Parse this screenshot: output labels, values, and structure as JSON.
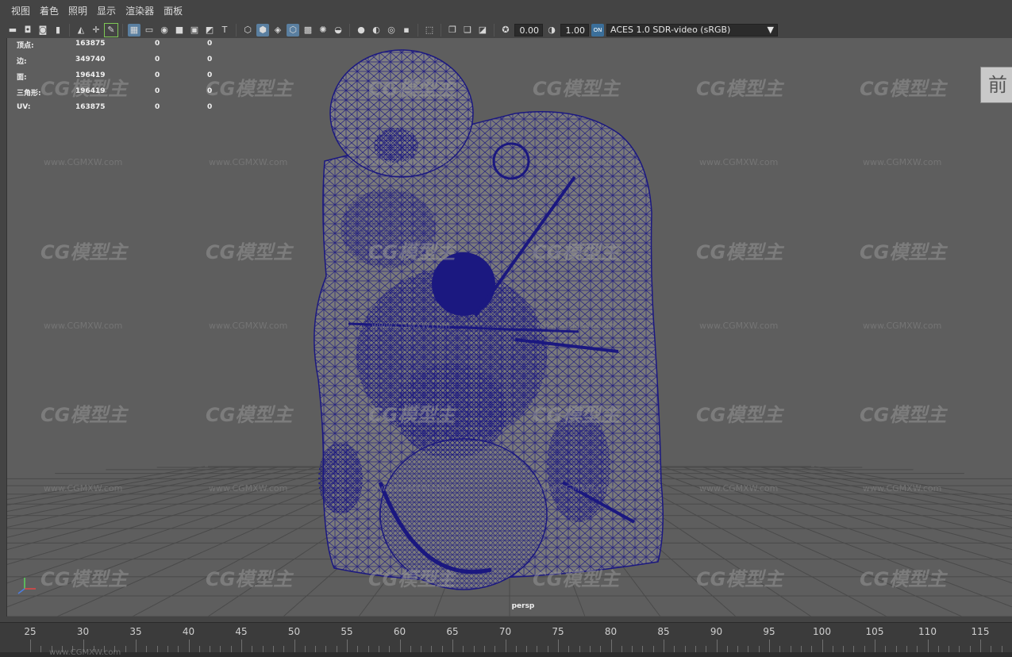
{
  "menu": {
    "items": [
      "视图",
      "着色",
      "照明",
      "显示",
      "渲染器",
      "面板"
    ]
  },
  "toolbar": {
    "exposure_value": "0.00",
    "gamma_value": "1.00",
    "color_space": "ACES 1.0 SDR-video (sRGB)",
    "color_space_badge": "ON",
    "icons": [
      "camera-icon",
      "film-camera-icon",
      "select-camera-icon",
      "bookmark-icon",
      "image-plane-icon",
      "grid-icon",
      "pencil-icon",
      "grid-toggle-icon",
      "film-gate-icon",
      "resolution-gate-icon",
      "gate-mask-icon",
      "field-chart-icon",
      "safe-action-icon",
      "safe-title-icon",
      "wireframe-icon",
      "smooth-shade-icon",
      "wireframe-on-shaded-icon",
      "xray-icon",
      "default-lighting-icon",
      "textures-icon",
      "shadows-icon",
      "ambient-occlusion-icon",
      "motion-blur-icon",
      "antialiasing-icon",
      "isolate-select-icon",
      "xray-joints-icon",
      "frame-all-icon",
      "frame-selection-icon",
      "exposure-icon",
      "gamma-icon",
      "view-transform-icon"
    ]
  },
  "hud": {
    "rows": [
      {
        "label": "顶点:",
        "v1": "163875",
        "v2": "0",
        "v3": "0"
      },
      {
        "label": "边:",
        "v1": "349740",
        "v2": "0",
        "v3": "0"
      },
      {
        "label": "面:",
        "v1": "196419",
        "v2": "0",
        "v3": "0"
      },
      {
        "label": "三角形:",
        "v1": "196419",
        "v2": "0",
        "v3": "0"
      },
      {
        "label": "UV:",
        "v1": "163875",
        "v2": "0",
        "v3": "0"
      }
    ]
  },
  "viewport": {
    "camera_label": "persp",
    "view_cube_label": "前",
    "axis_labels": {
      "y": "y",
      "x": "x",
      "z": "z"
    },
    "watermark": "CG模型主",
    "watermark_url": "www.CGMXW.com"
  },
  "timeline": {
    "frames": [
      "25",
      "30",
      "35",
      "40",
      "45",
      "50",
      "55",
      "60",
      "65",
      "70",
      "75",
      "80",
      "85",
      "90",
      "95",
      "100",
      "105",
      "110",
      "115"
    ]
  },
  "colors": {
    "background": "#444444",
    "viewport": "#5e5e5e",
    "wireframe": "#1b1880",
    "mesh_fill": "#7a7a7a",
    "accent": "#5a7fa0"
  }
}
